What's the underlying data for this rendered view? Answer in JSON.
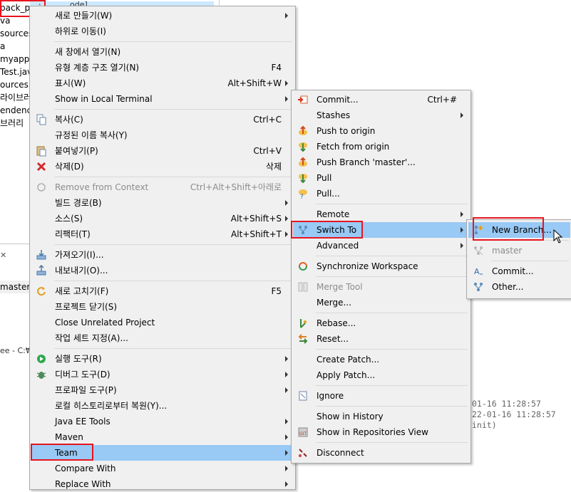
{
  "explorer": {
    "items": [
      "pack_proj",
      "va",
      "sources",
      "a",
      "myapp",
      "Test.java",
      "ources",
      "라이브러",
      "endenci",
      "브러리"
    ],
    "top_text": "ode]"
  },
  "bottom_panel": {
    "branch_label": "master]",
    "ee_label": "ee - C:₩"
  },
  "history_log": [
    "01-16 11:28:57",
    "22-01-16 11:28:57",
    "init)"
  ],
  "context_menu": [
    {
      "label": "새로 만들기(W)",
      "shortcut": "",
      "submenu": true,
      "icon": ""
    },
    {
      "label": "하위로 이동(I)",
      "shortcut": "",
      "submenu": false,
      "icon": ""
    },
    {
      "label": "새 창에서 열기(N)",
      "shortcut": "",
      "submenu": false,
      "icon": ""
    },
    {
      "label": "유형 계층 구조 열기(N)",
      "shortcut": "F4",
      "submenu": false,
      "icon": ""
    },
    {
      "label": "표시(W)",
      "shortcut": "Alt+Shift+W",
      "submenu": true,
      "icon": ""
    },
    {
      "label": "Show in Local Terminal",
      "shortcut": "",
      "submenu": true,
      "icon": ""
    },
    {
      "label": "복사(C)",
      "shortcut": "Ctrl+C",
      "submenu": false,
      "icon": "copy-icon"
    },
    {
      "label": "규정된 이름 복사(Y)",
      "shortcut": "",
      "submenu": false,
      "icon": ""
    },
    {
      "label": "붙여넣기(P)",
      "shortcut": "Ctrl+V",
      "submenu": false,
      "icon": "paste-icon"
    },
    {
      "label": "삭제(D)",
      "shortcut": "삭제",
      "submenu": false,
      "icon": "delete-icon"
    },
    {
      "label": "Remove from Context",
      "shortcut": "Ctrl+Alt+Shift+아래로",
      "submenu": false,
      "icon": "remove-context-icon",
      "disabled": true
    },
    {
      "label": "빌드 경로(B)",
      "shortcut": "",
      "submenu": true,
      "icon": ""
    },
    {
      "label": "소스(S)",
      "shortcut": "Alt+Shift+S",
      "submenu": true,
      "icon": ""
    },
    {
      "label": "리팩터(T)",
      "shortcut": "Alt+Shift+T",
      "submenu": true,
      "icon": ""
    },
    {
      "label": "가져오기(I)...",
      "shortcut": "",
      "submenu": false,
      "icon": "import-icon"
    },
    {
      "label": "내보내기(O)...",
      "shortcut": "",
      "submenu": false,
      "icon": "export-icon"
    },
    {
      "label": "새로 고치기(F)",
      "shortcut": "F5",
      "submenu": false,
      "icon": "refresh-icon"
    },
    {
      "label": "프로젝트 닫기(S)",
      "shortcut": "",
      "submenu": false,
      "icon": ""
    },
    {
      "label": "Close Unrelated Project",
      "shortcut": "",
      "submenu": false,
      "icon": ""
    },
    {
      "label": "작업 세트 지정(A)...",
      "shortcut": "",
      "submenu": false,
      "icon": ""
    },
    {
      "label": "실행 도구(R)",
      "shortcut": "",
      "submenu": true,
      "icon": "run-icon"
    },
    {
      "label": "디버그 도구(D)",
      "shortcut": "",
      "submenu": true,
      "icon": "debug-icon"
    },
    {
      "label": "프로파일 도구(P)",
      "shortcut": "",
      "submenu": true,
      "icon": ""
    },
    {
      "label": "로컬 히스토리로부터 복원(Y)...",
      "shortcut": "",
      "submenu": false,
      "icon": ""
    },
    {
      "label": "Java EE Tools",
      "shortcut": "",
      "submenu": true,
      "icon": ""
    },
    {
      "label": "Maven",
      "shortcut": "",
      "submenu": true,
      "icon": ""
    },
    {
      "label": "Team",
      "shortcut": "",
      "submenu": true,
      "icon": "",
      "highlighted": true
    },
    {
      "label": "Compare With",
      "shortcut": "",
      "submenu": true,
      "icon": ""
    },
    {
      "label": "Replace With",
      "shortcut": "",
      "submenu": true,
      "icon": ""
    }
  ],
  "team_menu": [
    {
      "label": "Commit...",
      "shortcut": "Ctrl+#",
      "submenu": false,
      "icon": "commit-icon"
    },
    {
      "label": "Stashes",
      "shortcut": "",
      "submenu": true,
      "icon": ""
    },
    {
      "label": "Push to origin",
      "shortcut": "",
      "submenu": false,
      "icon": "push-icon"
    },
    {
      "label": "Fetch from origin",
      "shortcut": "",
      "submenu": false,
      "icon": "fetch-icon"
    },
    {
      "label": "Push Branch 'master'...",
      "shortcut": "",
      "submenu": false,
      "icon": "push-branch-icon"
    },
    {
      "label": "Pull",
      "shortcut": "",
      "submenu": false,
      "icon": "pull-icon"
    },
    {
      "label": "Pull...",
      "shortcut": "",
      "submenu": false,
      "icon": "pull-dialog-icon"
    },
    {
      "label": "Remote",
      "shortcut": "",
      "submenu": true,
      "icon": ""
    },
    {
      "label": "Switch To",
      "shortcut": "",
      "submenu": true,
      "icon": "switch-branch-icon",
      "highlighted": true
    },
    {
      "label": "Advanced",
      "shortcut": "",
      "submenu": true,
      "icon": ""
    },
    {
      "label": "Synchronize Workspace",
      "shortcut": "",
      "submenu": false,
      "icon": "synchronize-icon"
    },
    {
      "label": "Merge Tool",
      "shortcut": "",
      "submenu": false,
      "icon": "merge-tool-icon",
      "disabled": true
    },
    {
      "label": "Merge...",
      "shortcut": "",
      "submenu": false,
      "icon": ""
    },
    {
      "label": "Rebase...",
      "shortcut": "",
      "submenu": false,
      "icon": "rebase-icon"
    },
    {
      "label": "Reset...",
      "shortcut": "",
      "submenu": false,
      "icon": "reset-icon"
    },
    {
      "label": "Create Patch...",
      "shortcut": "",
      "submenu": false,
      "icon": ""
    },
    {
      "label": "Apply Patch...",
      "shortcut": "",
      "submenu": false,
      "icon": ""
    },
    {
      "label": "Ignore",
      "shortcut": "",
      "submenu": false,
      "icon": "ignore-icon"
    },
    {
      "label": "Show in History",
      "shortcut": "",
      "submenu": false,
      "icon": ""
    },
    {
      "label": "Show in Repositories View",
      "shortcut": "",
      "submenu": false,
      "icon": "git-repo-icon"
    },
    {
      "label": "Disconnect",
      "shortcut": "",
      "submenu": false,
      "icon": "disconnect-icon"
    }
  ],
  "switch_menu": [
    {
      "label": "New Branch...",
      "icon": "new-branch-icon",
      "highlighted": true
    },
    {
      "label": "master",
      "icon": "branch-icon",
      "disabled": true
    },
    {
      "label": "Commit...",
      "icon": "commit-ref-icon"
    },
    {
      "label": "Other...",
      "icon": "other-branch-icon"
    }
  ],
  "colors": {
    "highlight": "#99c9f5",
    "menu_bg": "#f0f0f0",
    "annotation": "#e8141f"
  }
}
